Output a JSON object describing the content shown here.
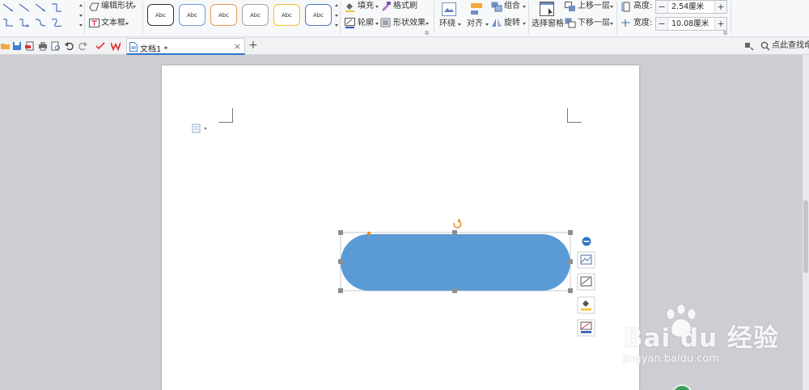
{
  "ribbon": {
    "edit_shape_label": "编辑形状",
    "text_box_label": "文本框",
    "shape_style_label": "Abc",
    "fill_label": "填充",
    "format_painter_label": "格式刷",
    "outline_label": "轮廓",
    "shape_effect_label": "形状效果",
    "wrap_label": "环绕",
    "align_label": "对齐",
    "group_label": "组合",
    "rotate_label": "旋转",
    "selection_pane_label": "选择窗格",
    "bring_forward_label": "上移一层",
    "send_backward_label": "下移一层",
    "height_label": "高度:",
    "height_value": "2.54厘米",
    "width_label": "宽度:",
    "width_value": "10.08厘米",
    "minus": "−",
    "plus": "+"
  },
  "tabbar": {
    "doc_tab_title": "文档1 *",
    "close_glyph": "×",
    "add_glyph": "+",
    "search_command_label": "点此查找命令"
  },
  "watermark": {
    "brand": "Bai du 经验",
    "url": "jingyan.baidu.com"
  },
  "colors": {
    "shape_fill": "#5b9bd5",
    "accent": "#2f76c8",
    "style_borders": [
      "#333333",
      "#6a9bd5",
      "#ee9a4d",
      "#a5a5a5",
      "#f5c12b",
      "#4a7bc0"
    ]
  }
}
